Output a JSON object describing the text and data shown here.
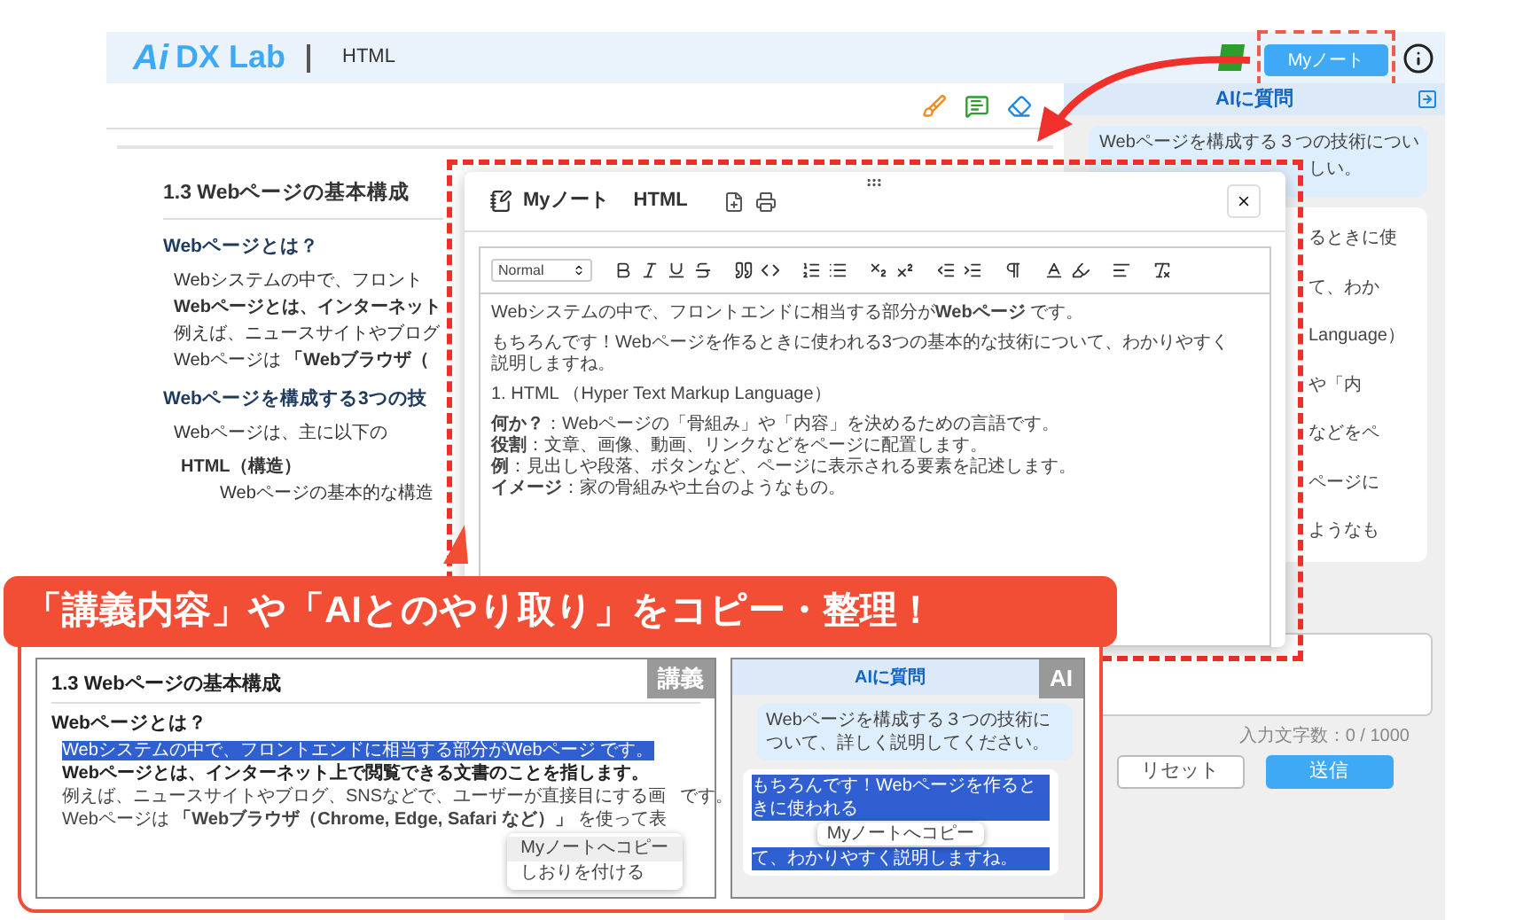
{
  "header": {
    "logo_mark": "Ai",
    "logo_text": "DX Lab",
    "course": "HTML",
    "note_button": "Myノート"
  },
  "lecture": {
    "title": "1.3 Webページの基本構成",
    "sections": [
      {
        "heading": "Webページとは？",
        "blocks": [
          {
            "kind": "text",
            "text": "Webシステムの中で、フロント"
          },
          {
            "kind": "strong",
            "text": "Webページとは、インターネット"
          },
          {
            "kind": "text",
            "text": "例えば、ニュースサイトやブログ"
          },
          {
            "kind": "text",
            "text": "Webページは **「Webブラウザ（**"
          }
        ]
      },
      {
        "heading": "Webページを構成する3つの技",
        "blocks": [
          {
            "kind": "text",
            "text": "Webページは、主に以下の"
          },
          {
            "kind": "item_title",
            "text": "HTML（構造）"
          },
          {
            "kind": "item_text",
            "text": "Webページの基本的な構造"
          }
        ]
      }
    ]
  },
  "ai_panel": {
    "title": "AIに質問",
    "user_message": [
      "Webページを構成する３つの技術につい",
      "しい。"
    ],
    "reply_fragments": [
      "るときに使",
      "て、わか",
      "Language）",
      "や「内",
      "などをペ",
      "ページに",
      "ようなも"
    ],
    "counter": "入力文字数：0 / 1000",
    "buttons": [
      {
        "label": "リセット",
        "kind": "secondary"
      },
      {
        "label": "送信",
        "kind": "primary"
      }
    ]
  },
  "note_modal": {
    "title": "Myノート",
    "course": "HTML",
    "style_select": "Normal",
    "paragraphs": [
      [
        "Webシステムの中で、フロントエンドに相当する部分が**Webページ** です。"
      ],
      [
        "もちろんです！Webページを作るときに使われる3つの基本的な技術について、わかりやすく説明しますね。"
      ],
      [
        "1. HTML （Hyper Text Markup Language）"
      ],
      [
        "**何か？**：Webページの「骨組み」や「内容」を決めるための言語です。",
        "**役割**：文章、画像、動画、リンクなどをページに配置します。",
        "**例**：見出しや段落、ボタンなど、ページに表示される要素を記述します。",
        "**イメージ**：家の骨組みや土台のようなもの。"
      ]
    ]
  },
  "callout": {
    "banner": "「講義内容」や「AIとのやり取り」をコピー・整理！",
    "lecture_preview": {
      "tag": "講義",
      "title": "1.3 Webページの基本構成",
      "heading": "Webページとは？",
      "lines": [
        {
          "kind": "highlighted",
          "text": "Webシステムの中で、フロントエンドに相当する部分がWebページ です。"
        },
        {
          "kind": "strong",
          "text": "Webページとは、インターネット上で閲覧できる文書のことを指します。"
        },
        {
          "kind": "split",
          "parts": [
            "例えば、ニュースサイトやブログ、SNSなどで、ユーザーが直接目にする画",
            "です。"
          ]
        },
        {
          "kind": "rich",
          "text": "Webページは **「Webブラウザ（Chrome, Edge, Safari など）」** を使って表"
        }
      ],
      "menu": [
        {
          "label": "Myノートへコピー",
          "selected": true
        },
        {
          "label": "しおりを付ける",
          "selected": false
        }
      ]
    },
    "ai_preview": {
      "tag": "AI",
      "title": "AIに質問",
      "user_message": "Webページを構成する３つの技術について、詳しく説明してください。",
      "reply_before": "もちろんです！Webページを作るときに使われる",
      "popup": "Myノートへコピー",
      "reply_after": "て、わかりやすく説明しますね。"
    }
  }
}
